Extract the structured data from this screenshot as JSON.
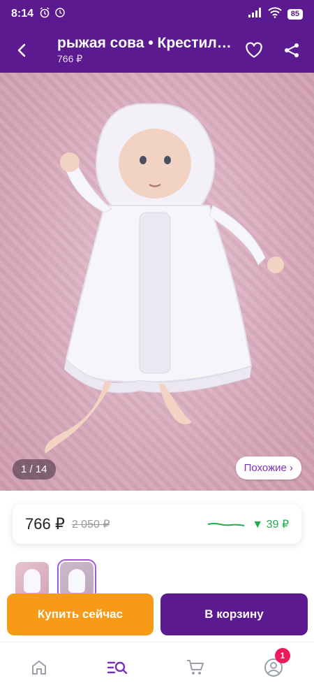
{
  "status_bar": {
    "time": "8:14",
    "battery": "85",
    "icons": [
      "alarm-icon",
      "clock-icon",
      "signal-icon",
      "wifi-icon",
      "battery-icon"
    ]
  },
  "app_bar": {
    "title": "рыжая сова • Крестильная...",
    "subtitle": "766 ₽",
    "icons": [
      "back-arrow-icon",
      "heart-icon",
      "share-icon"
    ]
  },
  "gallery": {
    "counter": "1 / 14",
    "similar_label": "Похожие ›"
  },
  "price": {
    "current": "766 ₽",
    "old": "2 050 ₽",
    "change": "▼ 39 ₽",
    "trend_color": "#1fae4a"
  },
  "actions": {
    "buy_now": "Купить сейчас",
    "add_to_cart": "В корзину"
  },
  "bottom_nav": {
    "items": [
      "home-icon",
      "catalog-search-icon",
      "cart-icon",
      "profile-icon"
    ],
    "profile_badge": "1"
  },
  "colors": {
    "brand": "#5b1a8f",
    "buy_now": "#f79a18",
    "accent_link": "#7b2fbf",
    "badge": "#f0195b"
  }
}
